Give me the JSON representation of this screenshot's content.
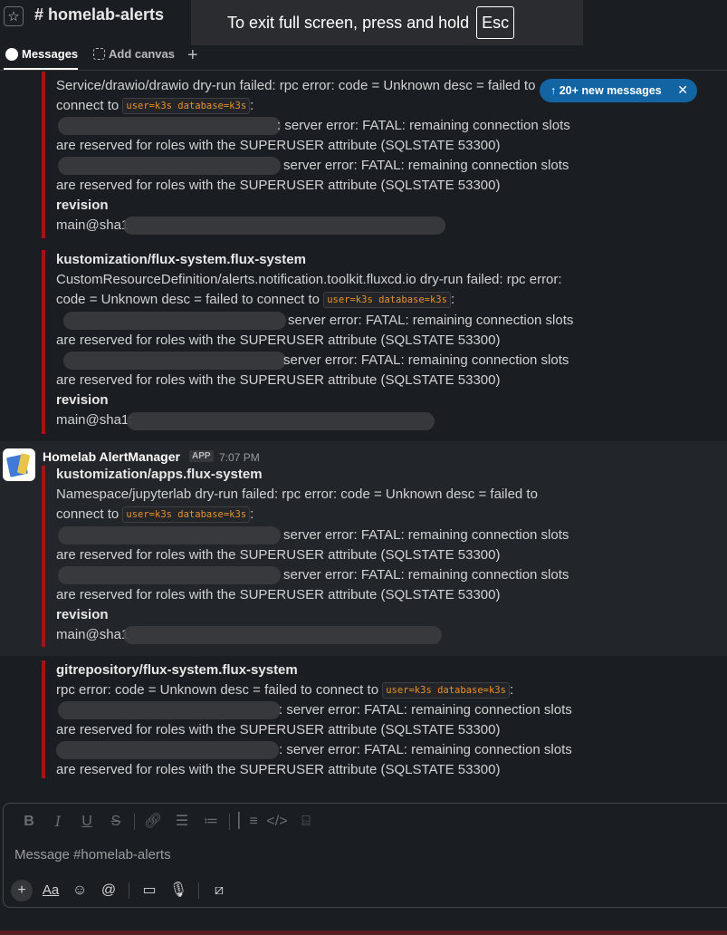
{
  "header": {
    "channel": "# homelab-alerts",
    "fullscreen_prefix": "To exit full screen, press and hold",
    "fullscreen_key": "Esc"
  },
  "tabs": [
    {
      "label": "Messages",
      "active": true
    },
    {
      "label": "Add canvas",
      "active": false
    }
  ],
  "new_messages": {
    "label": "↑ 20+ new messages"
  },
  "messages": {
    "m1": {
      "l1": "Service/drawio/drawio dry-run failed: rpc error: code = Unknown desc = failed to",
      "l2_prefix": "connect to",
      "code": "user=k3s database=k3s",
      "l2_suffix": ":",
      "l3": ": server error: FATAL: remaining connection slots",
      "l4": "are reserved for roles with the SUPERUSER attribute (SQLSTATE 53300)",
      "l5": "server error: FATAL: remaining connection slots",
      "l6": "are reserved for roles with the SUPERUSER attribute (SQLSTATE 53300)",
      "revision": "revision",
      "rev_value": "main@sha1"
    },
    "m2": {
      "title": "kustomization/flux-system.flux-system",
      "l1": "CustomResourceDefinition/alerts.notification.toolkit.fluxcd.io dry-run failed: rpc error:",
      "l2_prefix": "code = Unknown desc = failed to connect to",
      "code": "user=k3s database=k3s",
      "l2_suffix": ":",
      "l3": "server error: FATAL: remaining connection slots",
      "l4": "are reserved for roles with the SUPERUSER attribute (SQLSTATE 53300)",
      "l5": "server error: FATAL: remaining connection slots",
      "l6": "are reserved for roles with the SUPERUSER attribute (SQLSTATE 53300)",
      "revision": "revision",
      "rev_value": "main@sha1:"
    },
    "m3": {
      "sender": "Homelab AlertManager",
      "badge": "APP",
      "time": "7:07 PM",
      "title": "kustomization/apps.flux-system",
      "l1": "Namespace/jupyterlab dry-run failed: rpc error: code = Unknown desc = failed to",
      "l2_prefix": "connect to",
      "code": "user=k3s database=k3s",
      "l2_suffix": ":",
      "l3": "server error: FATAL: remaining connection slots",
      "l4": "are reserved for roles with the SUPERUSER attribute (SQLSTATE 53300)",
      "l5": "server error: FATAL: remaining connection slots",
      "l6": "are reserved for roles with the SUPERUSER attribute (SQLSTATE 53300)",
      "revision": "revision",
      "rev_value": "main@sha1"
    },
    "m4": {
      "title": "gitrepository/flux-system.flux-system",
      "l1_prefix": "rpc error: code = Unknown desc = failed to connect to",
      "code": "user=k3s database=k3s",
      "l1_suffix": ":",
      "l3": ": server error: FATAL: remaining connection slots",
      "l4": "are reserved for roles with the SUPERUSER attribute (SQLSTATE 53300)",
      "l5": ": server error: FATAL: remaining connection slots",
      "l6": "are reserved for roles with the SUPERUSER attribute (SQLSTATE 53300)"
    }
  },
  "composer": {
    "placeholder": "Message #homelab-alerts",
    "format_icons": [
      "bold-icon",
      "italic-icon",
      "underline-icon",
      "strikethrough-icon",
      "link-icon",
      "ordered-list-icon",
      "bulleted-list-icon",
      "blockquote-icon",
      "code-icon",
      "code-block-icon"
    ],
    "action_icons": [
      "plus-icon",
      "text-format-icon",
      "emoji-icon",
      "mention-icon",
      "video-icon",
      "microphone-icon",
      "slash-command-icon"
    ],
    "aa_label": "Aa"
  },
  "colors": {
    "background": "#1a1d21",
    "attachment_bar": "#a31515",
    "code_text": "#e8912d",
    "new_messages_bg": "#1264a3"
  }
}
